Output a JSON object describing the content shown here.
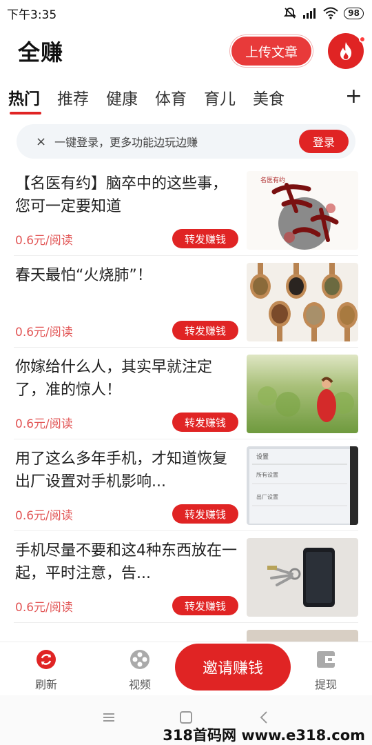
{
  "status_bar": {
    "time": "下午3:35",
    "battery": "98"
  },
  "header": {
    "title": "全赚",
    "upload_label": "上传文章",
    "fire_icon": "fire-icon"
  },
  "tabs": [
    {
      "label": "热门",
      "active": true
    },
    {
      "label": "推荐"
    },
    {
      "label": "健康"
    },
    {
      "label": "体育"
    },
    {
      "label": "育儿"
    },
    {
      "label": "美食"
    }
  ],
  "tab_plus": "+",
  "login_banner": {
    "close": "×",
    "text": "一键登录，更多功能边玩边赚",
    "button": "登录"
  },
  "articles": [
    {
      "title": "【名医有约】脑卒中的这些事，您可一定要知道",
      "price": "0.6元/阅读",
      "share": "转发赚钱"
    },
    {
      "title": "春天最怕“火烧肺”！",
      "price": "0.6元/阅读",
      "share": "转发赚钱"
    },
    {
      "title": "你嫁给什么人，其实早就注定了，准的惊人！",
      "price": "0.6元/阅读",
      "share": "转发赚钱"
    },
    {
      "title": "用了这么多年手机，才知道恢复出厂设置对手机影响...",
      "price": "0.6元/阅读",
      "share": "转发赚钱"
    },
    {
      "title": "手机尽量不要和这4种东西放在一起，平时注意，告...",
      "price": "0.6元/阅读",
      "share": "转发赚钱"
    },
    {
      "title": "",
      "price": "",
      "share": ""
    }
  ],
  "thumb_text": {
    "logo_small": "名医有约",
    "settings_lines": [
      "设置",
      "所有设置",
      "出厂设置"
    ]
  },
  "bottom_nav": {
    "refresh": "刷新",
    "video": "视频",
    "invite": "邀请赚钱",
    "withdraw": "提现"
  },
  "watermark": "318首码网 www.e318.com"
}
